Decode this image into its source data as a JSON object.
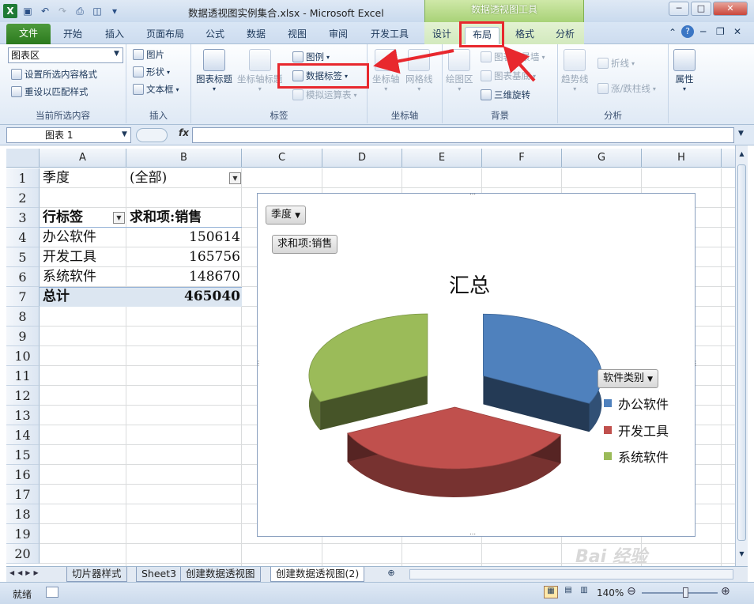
{
  "window": {
    "title": "数据透视图实例集合.xlsx  -  Microsoft Excel",
    "context_tool": "数据透视图工具",
    "buttons": [
      "─",
      "□",
      "✕"
    ]
  },
  "tabs": {
    "file": "文件",
    "items": [
      "开始",
      "插入",
      "页面布局",
      "公式",
      "数据",
      "视图",
      "审阅",
      "开发工具",
      "设计",
      "布局",
      "格式",
      "分析"
    ]
  },
  "ribbon": {
    "current_selection": {
      "dropdown": "图表区",
      "format_selection": "设置所选内容格式",
      "reset_style": "重设以匹配样式",
      "label": "当前所选内容"
    },
    "insert": {
      "picture": "图片",
      "shapes": "形状",
      "textbox": "文本框",
      "label": "插入"
    },
    "labels": {
      "chart_title": "图表标题",
      "axis_titles": "坐标轴标题",
      "legend": "图例",
      "data_labels": "数据标签",
      "data_table": "模拟运算表",
      "label": "标签"
    },
    "axes": {
      "axes": "坐标轴",
      "gridlines": "网格线",
      "label": "坐标轴"
    },
    "background": {
      "plot_area": "绘图区",
      "chart_wall": "图表背景墙",
      "chart_floor": "图表基底",
      "rotation": "三维旋转",
      "label": "背景"
    },
    "analysis": {
      "trendline": "趋势线",
      "lines": "折线",
      "updown_bars": "涨/跌柱线",
      "label": "分析"
    },
    "properties": {
      "label": "属性"
    }
  },
  "formula_bar": {
    "name_box": "图表 1",
    "fx": "fx",
    "value": ""
  },
  "sheet": {
    "columns": [
      "A",
      "B",
      "C",
      "D",
      "E",
      "F",
      "G",
      "H"
    ],
    "rows": [
      "1",
      "2",
      "3",
      "4",
      "5",
      "6",
      "7",
      "8",
      "9",
      "10",
      "11",
      "12",
      "13",
      "14",
      "15",
      "16",
      "17",
      "18",
      "19",
      "20"
    ],
    "filter_label": "季度",
    "filter_value": "(全部)",
    "row_label_header": "行标签",
    "value_header": "求和项:销售",
    "data": [
      {
        "label": "办公软件",
        "value": "150614"
      },
      {
        "label": "开发工具",
        "value": "165756"
      },
      {
        "label": "系统软件",
        "value": "148670"
      }
    ],
    "total_label": "总计",
    "total_value": "465040"
  },
  "chart_data": {
    "type": "pie",
    "title": "汇总",
    "categories": [
      "办公软件",
      "开发工具",
      "系统软件"
    ],
    "values": [
      150614,
      165756,
      148670
    ],
    "colors": [
      "#4f81bd",
      "#c0504d",
      "#9bbb59"
    ],
    "legend_title": "软件类别",
    "legend_position": "right",
    "filter_button": "季度",
    "value_button": "求和项:销售"
  },
  "sheet_tabs": [
    "切片器样式",
    "Sheet3",
    "创建数据透视图",
    "创建数据透视图(2)"
  ],
  "status": {
    "ready": "就绪",
    "zoom": "140%"
  },
  "colors": {
    "highlight": "#e8282e",
    "file_tab": "#2b7a1d",
    "context": "#a8d277"
  }
}
